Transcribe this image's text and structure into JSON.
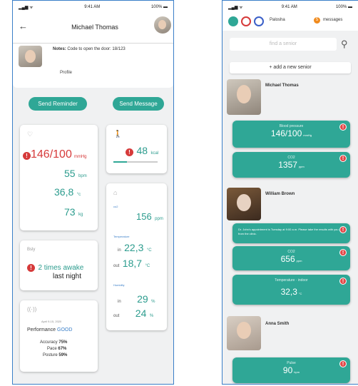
{
  "left": {
    "status": {
      "time": "9:41 AM",
      "battery": "100%"
    },
    "header": {
      "title": "Michael Thomas"
    },
    "notes": {
      "label": "Notes:",
      "text": "Code to open the door: 18/123"
    },
    "profile_button": "Profile",
    "send_reminder": "Send Reminder",
    "send_message": "Send Message",
    "vitals": {
      "bp_value": "146/100",
      "bp_unit": "mmHg",
      "pulse_value": "55",
      "pulse_unit": "bpm",
      "temp_value": "36,8",
      "temp_unit": "°c",
      "weight_value": "73",
      "weight_unit": "kg"
    },
    "activity": {
      "value": "48",
      "unit": "kcal",
      "progress": 0.3
    },
    "sleep": {
      "label": "Bsly",
      "value": "2 times awake",
      "sub": "last night"
    },
    "performance": {
      "date": "April 9-15, 2020",
      "label": "Performance",
      "rating": "GOOD",
      "accuracy_label": "Accuracy",
      "accuracy": "75%",
      "pace_label": "Pace",
      "pace": "67%",
      "posture_label": "Posture",
      "posture": "59%"
    },
    "environment": {
      "co2_label": "co2",
      "co2_value": "156",
      "co2_unit": "ppm",
      "temp_label": "Temperature",
      "temp_in_label": "in",
      "temp_in": "22,3",
      "temp_out_label": "out",
      "temp_out": "18,7",
      "temp_unit": "°C",
      "humidity_label": "Humidity",
      "hum_in_label": "in",
      "hum_in": "29",
      "hum_out_label": "out",
      "hum_out": "24",
      "hum_unit": "%"
    }
  },
  "right": {
    "status": {
      "time": "9:41 AM",
      "battery": "100%"
    },
    "header": {
      "user": "Palosha",
      "messages_count": "5",
      "messages_label": "messages"
    },
    "search": {
      "placeholder": "find a senior"
    },
    "add_senior": "+ add a new senior",
    "seniors": [
      {
        "name": "Michael Thomas",
        "cards": [
          {
            "label": "Blood pressure",
            "value": "146/100",
            "unit": "mmHg"
          },
          {
            "label": "CO2",
            "value": "1357",
            "unit": "ppm"
          }
        ]
      },
      {
        "name": "William Brown",
        "note": "Dr. John's appointment is Tuesday at 9:00 a.m. Please take the results with you from the clinic.",
        "cards": [
          {
            "label": "CO2",
            "value": "656",
            "unit": "ppm"
          },
          {
            "label": "Temperature · indoor",
            "value": "32,3",
            "unit": "°C"
          }
        ]
      },
      {
        "name": "Anna Smith",
        "cards": [
          {
            "label": "Pulse",
            "value": "90",
            "unit": "bpm"
          }
        ]
      }
    ]
  },
  "colors": {
    "teal": "#2fa796",
    "alert": "#d63a3a",
    "frame": "#3a7fc8"
  }
}
